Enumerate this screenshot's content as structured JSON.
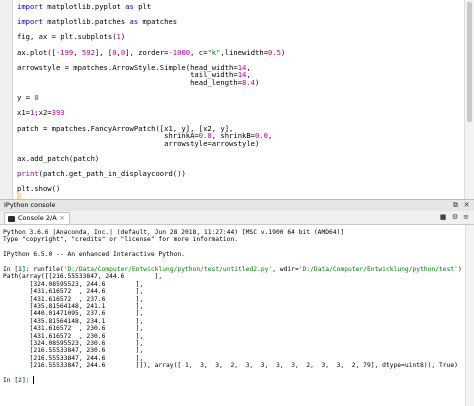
{
  "editor": {
    "lines": [
      {
        "segments": [
          {
            "t": "import",
            "c": "kw"
          },
          {
            "t": " matplotlib.pyplot ",
            "c": "ok"
          },
          {
            "t": "as",
            "c": "kw"
          },
          {
            "t": " plt",
            "c": "ok"
          }
        ]
      },
      {
        "segments": []
      },
      {
        "segments": [
          {
            "t": "import",
            "c": "kw"
          },
          {
            "t": " matplotlib.patches ",
            "c": "ok"
          },
          {
            "t": "as",
            "c": "kw"
          },
          {
            "t": " mpatches",
            "c": "ok"
          }
        ]
      },
      {
        "segments": []
      },
      {
        "segments": [
          {
            "t": "fig, ax = plt.subplots(",
            "c": "ok"
          },
          {
            "t": "1",
            "c": "num"
          },
          {
            "t": ")",
            "c": "ok"
          }
        ]
      },
      {
        "segments": []
      },
      {
        "segments": [
          {
            "t": "ax.plot([",
            "c": "ok"
          },
          {
            "t": "-199",
            "c": "num"
          },
          {
            "t": ", ",
            "c": "ok"
          },
          {
            "t": "592",
            "c": "num"
          },
          {
            "t": "], [",
            "c": "ok"
          },
          {
            "t": "0",
            "c": "num"
          },
          {
            "t": ",",
            "c": "ok"
          },
          {
            "t": "0",
            "c": "num"
          },
          {
            "t": "], zorder=",
            "c": "ok"
          },
          {
            "t": "-1000",
            "c": "num"
          },
          {
            "t": ", c=",
            "c": "ok"
          },
          {
            "t": "\"k\"",
            "c": "str"
          },
          {
            "t": ",linewidth=",
            "c": "ok"
          },
          {
            "t": "0.5",
            "c": "num"
          },
          {
            "t": ")",
            "c": "ok"
          }
        ]
      },
      {
        "segments": []
      },
      {
        "segments": [
          {
            "t": "arrowstyle = mpatches.ArrowStyle.Simple(head_width=",
            "c": "ok"
          },
          {
            "t": "14",
            "c": "num"
          },
          {
            "t": ",",
            "c": "ok"
          }
        ]
      },
      {
        "segments": [
          {
            "t": "                                        tail_width=",
            "c": "ok"
          },
          {
            "t": "14",
            "c": "num"
          },
          {
            "t": ",",
            "c": "ok"
          }
        ]
      },
      {
        "segments": [
          {
            "t": "                                        head_length=",
            "c": "ok"
          },
          {
            "t": "8.4",
            "c": "num"
          },
          {
            "t": ")",
            "c": "ok"
          }
        ]
      },
      {
        "segments": []
      },
      {
        "segments": [
          {
            "t": "y = ",
            "c": "ok"
          },
          {
            "t": "0",
            "c": "num"
          }
        ]
      },
      {
        "segments": []
      },
      {
        "segments": [
          {
            "t": "x1=",
            "c": "ok"
          },
          {
            "t": "1",
            "c": "num"
          },
          {
            "t": ";x2=",
            "c": "ok"
          },
          {
            "t": "393",
            "c": "num"
          }
        ]
      },
      {
        "segments": []
      },
      {
        "segments": [
          {
            "t": "patch = mpatches.FancyArrowPatch([x1, y], [x2, y],",
            "c": "ok"
          }
        ]
      },
      {
        "segments": [
          {
            "t": "                                  shrinkA=",
            "c": "ok"
          },
          {
            "t": "0.0",
            "c": "num"
          },
          {
            "t": ", shrinkB=",
            "c": "ok"
          },
          {
            "t": "0.0",
            "c": "num"
          },
          {
            "t": ",",
            "c": "ok"
          }
        ]
      },
      {
        "segments": [
          {
            "t": "                                  arrowstyle=arrowstyle)",
            "c": "ok"
          }
        ]
      },
      {
        "segments": []
      },
      {
        "segments": [
          {
            "t": "ax.add_patch(patch)",
            "c": "ok"
          }
        ]
      },
      {
        "segments": []
      },
      {
        "segments": [
          {
            "t": "print",
            "c": "fn"
          },
          {
            "t": "(patch.get_path_in_displaycoord())",
            "c": "ok"
          }
        ]
      },
      {
        "segments": []
      },
      {
        "segments": [
          {
            "t": "plt.show()",
            "c": "ok"
          }
        ]
      },
      {
        "segments": [],
        "cursor": true
      }
    ]
  },
  "pane": {
    "title": "IPython console",
    "icons": [
      "undock-icon",
      "close-icon"
    ]
  },
  "tabbar": {
    "tab_label": "Console 2/A",
    "tab_close": "✕"
  },
  "console": {
    "lines": [
      {
        "text": "Python 3.6.6 |Anaconda, Inc.| (default, Jun 28 2018, 11:27:44) [MSC v.1900 64 bit (AMD64)]"
      },
      {
        "text": "Type \"copyright\", \"credits\" or \"license\" for more information."
      },
      {
        "text": ""
      },
      {
        "text": "IPython 6.5.0 -- An enhanced Interactive Python."
      },
      {
        "text": ""
      },
      {
        "prompt": "In [",
        "num": "1",
        "prompt_end": "]: ",
        "pre": "runfile(",
        "path1": "'D:/Data/Computer/Entwicklung/python/test/untitled2.py'",
        "mid": ", wdir=",
        "path2": "'D:/Data/Computer/Entwicklung/python/test'",
        "post": ")"
      },
      {
        "text": "Path(array([[216.55533847, 244.6        ],"
      },
      {
        "text": "       [324.08595523, 244.6        ],"
      },
      {
        "text": "       [431.616572  , 244.6        ],"
      },
      {
        "text": "       [431.616572  , 237.6        ],"
      },
      {
        "text": "       [435.81564148, 241.1        ],"
      },
      {
        "text": "       [440.01471095, 237.6        ],"
      },
      {
        "text": "       [435.81564148, 234.1        ],"
      },
      {
        "text": "       [431.616572  , 230.6        ],"
      },
      {
        "text": "       [431.616572  , 230.6        ],"
      },
      {
        "text": "       [324.08595523, 230.6        ],"
      },
      {
        "text": "       [216.55533847, 230.6        ],"
      },
      {
        "text": "       [216.55533847, 244.6        ],"
      },
      {
        "text": "       [216.55533847, 244.6        ]]), array([ 1,  3,  3,  2,  3,  3,  3,  3,  2,  3,  3,  2, 79], dtype=uint8)), True)"
      },
      {
        "text": ""
      },
      {
        "prompt": "In [",
        "num": "2",
        "prompt_end": "]: ",
        "caret": true
      }
    ]
  }
}
